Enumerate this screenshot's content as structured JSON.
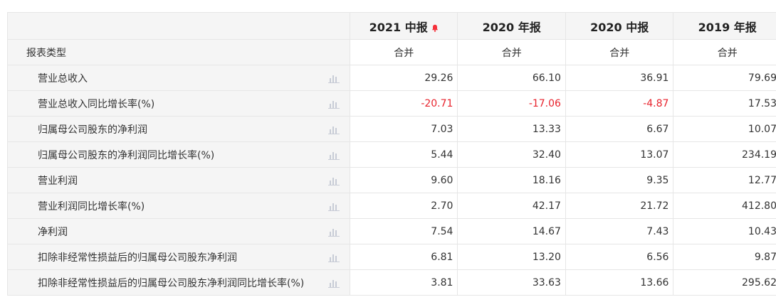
{
  "header": {
    "columns": [
      {
        "label": "2021 中报",
        "has_alert": true
      },
      {
        "label": "2020 年报",
        "has_alert": false
      },
      {
        "label": "2020 中报",
        "has_alert": false
      },
      {
        "label": "2019 年报",
        "has_alert": false
      }
    ],
    "alert_icon": "bell-icon",
    "alert_color": "#f5313b"
  },
  "report_type_row": {
    "label": "报表类型",
    "values": [
      "合并",
      "合并",
      "合并",
      "合并"
    ]
  },
  "rows": [
    {
      "label": "营业总收入",
      "values": [
        "29.26",
        "66.10",
        "36.91",
        "79.69"
      ]
    },
    {
      "label": "营业总收入同比增长率(%)",
      "values": [
        "-20.71",
        "-17.06",
        "-4.87",
        "17.53"
      ]
    },
    {
      "label": "归属母公司股东的净利润",
      "values": [
        "7.03",
        "13.33",
        "6.67",
        "10.07"
      ]
    },
    {
      "label": "归属母公司股东的净利润同比增长率(%)",
      "values": [
        "5.44",
        "32.40",
        "13.07",
        "234.19"
      ]
    },
    {
      "label": "营业利润",
      "values": [
        "9.60",
        "18.16",
        "9.35",
        "12.77"
      ]
    },
    {
      "label": "营业利润同比增长率(%)",
      "values": [
        "2.70",
        "42.17",
        "21.72",
        "412.80"
      ]
    },
    {
      "label": "净利润",
      "values": [
        "7.54",
        "14.67",
        "7.43",
        "10.43"
      ]
    },
    {
      "label": "扣除非经常性损益后的归属母公司股东净利润",
      "values": [
        "6.81",
        "13.20",
        "6.56",
        "9.87"
      ]
    },
    {
      "label": "扣除非经常性损益后的归属母公司股东净利润同比增长率(%)",
      "values": [
        "3.81",
        "33.63",
        "13.66",
        "295.62"
      ]
    }
  ],
  "row_icon": "bar-chart-icon",
  "colors": {
    "negative": "#e8232d",
    "header_bg": "#f5f5f5",
    "border": "#e6e6e6",
    "icon": "#c8ccd6"
  }
}
